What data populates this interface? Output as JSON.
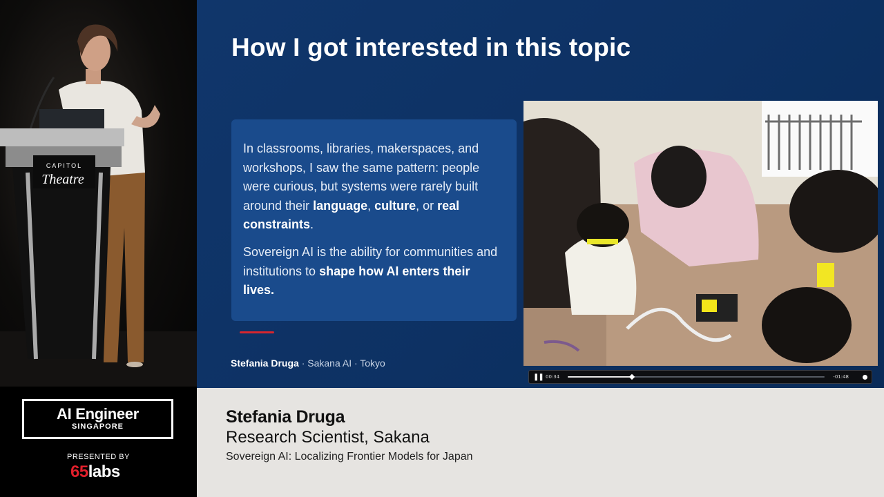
{
  "slide": {
    "title": "How I got interested in this topic",
    "callout": {
      "p1_plain1": "In classrooms, libraries, makerspaces, and workshops, I saw the same pattern: people were curious, but systems were rarely built around their ",
      "p1_bold1": "language",
      "p1_sep1": ", ",
      "p1_bold2": "culture",
      "p1_sep2": ", or ",
      "p1_bold3": "real constraints",
      "p1_end": ".",
      "p2_plain": "Sovereign AI is the ability for communities and institutions to ",
      "p2_bold": "shape how AI enters their lives."
    },
    "footer": {
      "author": "Stefania Druga",
      "affiliation": " · Sakana AI · Tokyo"
    },
    "video": {
      "elapsed": "00:34",
      "remaining": "-01:48",
      "progress": 0.25
    }
  },
  "podium": {
    "brand_top": "CAPITOL",
    "brand_script": "Theatre"
  },
  "branding": {
    "event_title": "AI Engineer",
    "event_location": "SINGAPORE",
    "presented_by": "PRESENTED BY",
    "sponsor_number": "65",
    "sponsor_word": "labs"
  },
  "lower_third": {
    "name": "Stefania Druga",
    "role": "Research Scientist, Sakana",
    "talk_title": "Sovereign AI: Localizing Frontier Models for Japan"
  },
  "colors": {
    "slide_bg": "#0d3163",
    "callout_bg": "#1a4b8c",
    "accent_red": "#d7262e",
    "lower_third_bg": "#e6e4e1",
    "sponsor_red": "#e11f2b"
  }
}
